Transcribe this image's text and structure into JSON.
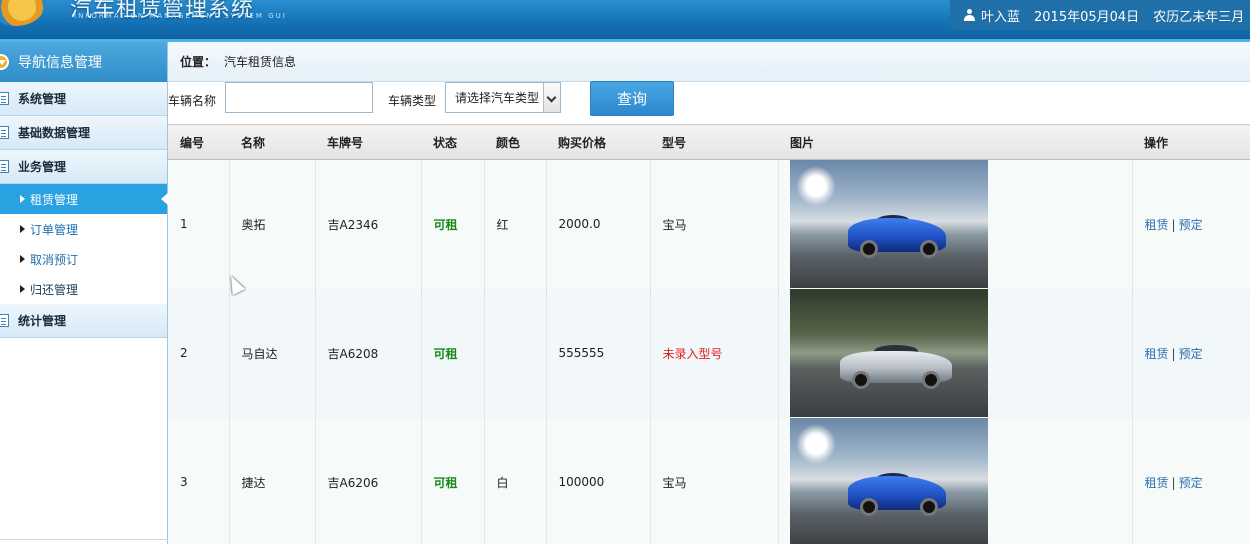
{
  "header": {
    "app_title": "汽车租赁管理系统",
    "app_subtitle": "INFORMATION MANAGEMENT SYSTEM GUI",
    "user_name": "叶入蓝",
    "date": "2015年05月04日",
    "lunar": "农历乙未年三月"
  },
  "sidebar": {
    "nav_title": "导航信息管理",
    "groups": [
      {
        "label": "系统管理"
      },
      {
        "label": "基础数据管理"
      },
      {
        "label": "业务管理"
      },
      {
        "label": "统计管理"
      }
    ],
    "subitems": [
      {
        "label": "租赁管理"
      },
      {
        "label": "订单管理"
      },
      {
        "label": "取消预订"
      },
      {
        "label": "归还管理"
      }
    ]
  },
  "breadcrumb": {
    "prefix": "位置：",
    "path": "汽车租赁信息"
  },
  "search": {
    "name_label": "车辆名称",
    "name_value": "",
    "type_label": "车辆类型",
    "type_selected": "请选择汽车类型",
    "query_button": "查询"
  },
  "table": {
    "headers": [
      "编号",
      "名称",
      "车牌号",
      "状态",
      "颜色",
      "购买价格",
      "型号",
      "图片",
      "操作"
    ],
    "rows": [
      {
        "id": "1",
        "name": "奥拓",
        "plate": "吉A2346",
        "status": "可租",
        "color": "红",
        "price": "2000.0",
        "model": "宝马",
        "image": "blue-sports-car",
        "op_rent": "租赁",
        "op_reserve": "预定"
      },
      {
        "id": "2",
        "name": "马自达",
        "plate": "吉A6208",
        "status": "可租",
        "color": "",
        "price": "555555",
        "model": "未录入型号",
        "image": "silver-coupe",
        "op_rent": "租赁",
        "op_reserve": "预定"
      },
      {
        "id": "3",
        "name": "捷达",
        "plate": "吉A6206",
        "status": "可租",
        "color": "白",
        "price": "100000",
        "model": "宝马",
        "image": "blue-sports-car",
        "op_rent": "租赁",
        "op_reserve": "预定"
      }
    ],
    "op_separator": "|"
  },
  "colors": {
    "header_blue": "#1471b5",
    "active_menu": "#2aa2e2",
    "status_green": "#1a8a1a",
    "missing_red": "#e02020",
    "link_blue": "#2a6fb0"
  }
}
